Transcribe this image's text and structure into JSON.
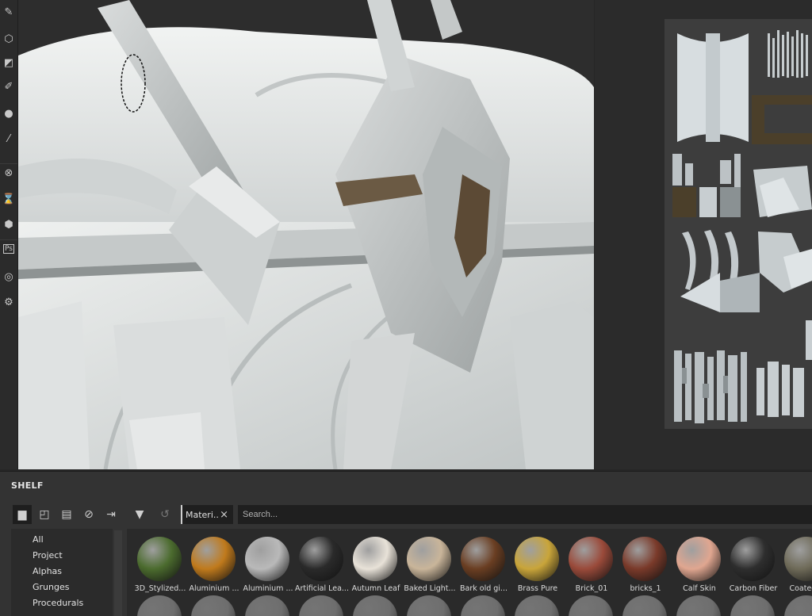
{
  "shelf": {
    "title": "SHELF",
    "filter_tag": "Materi..",
    "filter_close": "×",
    "search_placeholder": "Search...",
    "categories": [
      "All",
      "Project",
      "Alphas",
      "Grunges",
      "Procedurals"
    ],
    "assets": [
      {
        "label": "3D_Stylized...",
        "color": "#4b6b2e"
      },
      {
        "label": "Aluminium ...",
        "color": "#c07a1c"
      },
      {
        "label": "Aluminium ...",
        "color": "#b9b9b9"
      },
      {
        "label": "Artificial Lea...",
        "color": "#2a2a2a"
      },
      {
        "label": "Autumn Leaf",
        "color": "#e8e2d8"
      },
      {
        "label": "Baked Light...",
        "color": "#c9b59a"
      },
      {
        "label": "Bark old gi...",
        "color": "#6a3e22"
      },
      {
        "label": "Brass Pure",
        "color": "#c9a53a"
      },
      {
        "label": "Brick_01",
        "color": "#9a4a3a"
      },
      {
        "label": "bricks_1",
        "color": "#7a3a2a"
      },
      {
        "label": "Calf Skin",
        "color": "#e0a690"
      },
      {
        "label": "Carbon Fiber",
        "color": "#2e2e2e"
      },
      {
        "label": "Coated M",
        "color": "#6e6a58"
      }
    ]
  },
  "toolbar": {
    "icons": [
      "paint-brush-icon",
      "projection-icon",
      "polygon-fill-icon",
      "smudge-icon",
      "clone-icon",
      "color-picker-icon",
      "bake-icon",
      "material-icon",
      "layer-icon",
      "photoshop-export-icon",
      "camera-icon",
      "settings-icon"
    ],
    "ps_label": "Ps"
  }
}
